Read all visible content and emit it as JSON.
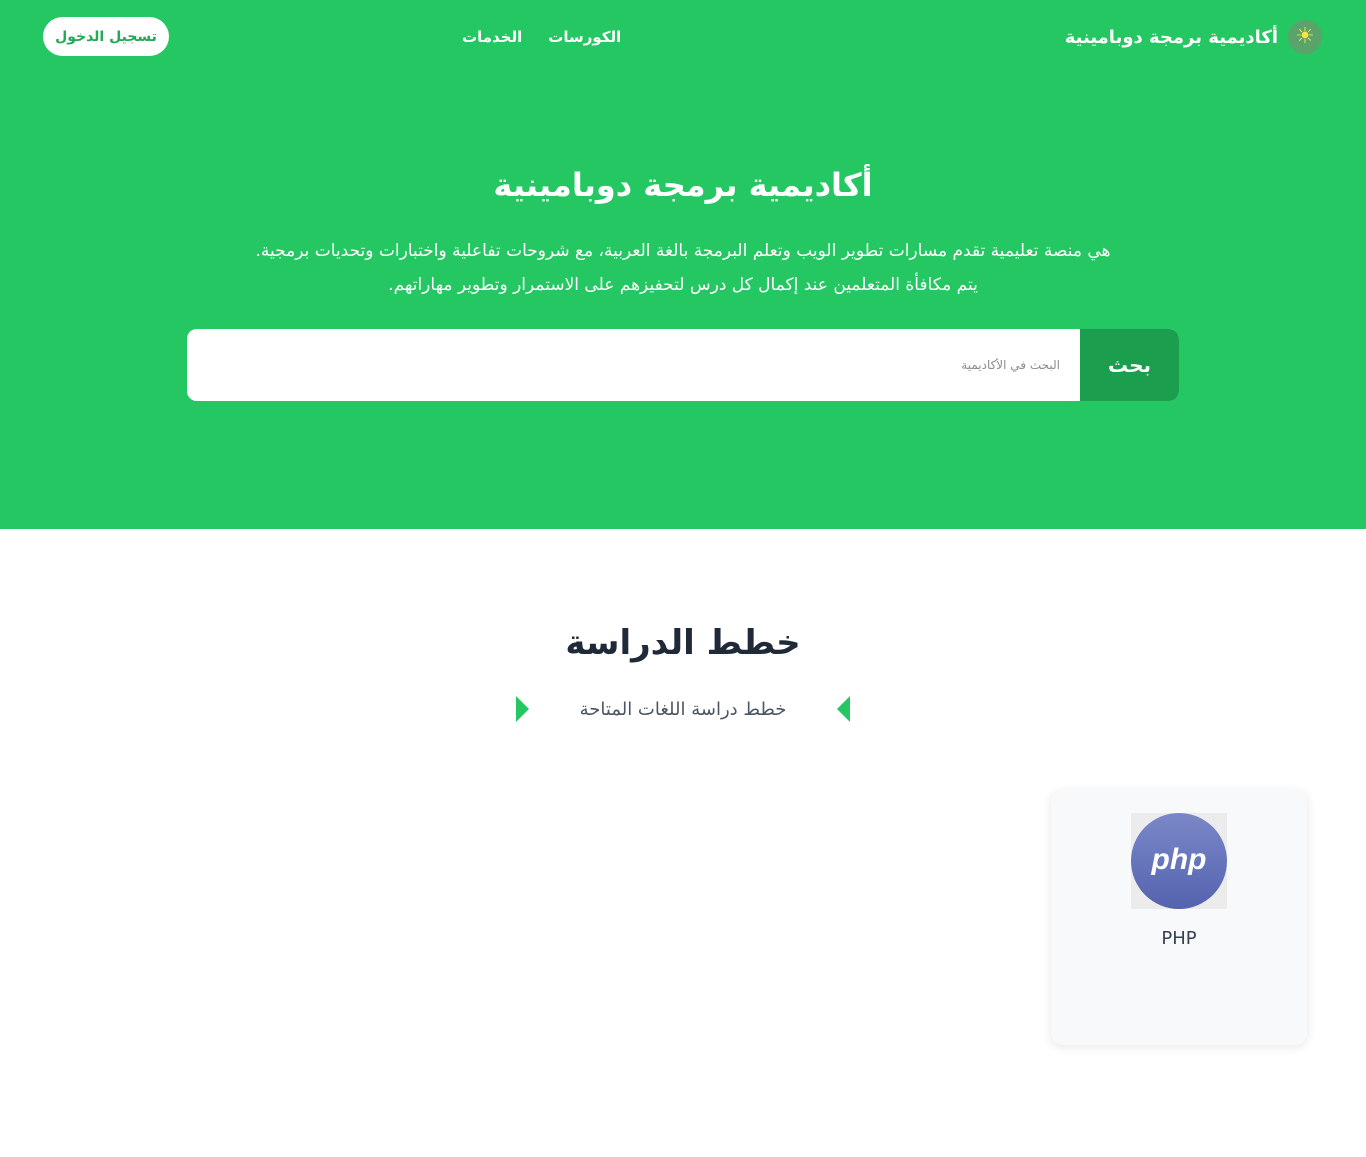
{
  "header": {
    "brand_icon": "sun-icon",
    "brand_name": "أكاديمية برمجة دوبامينية",
    "nav": [
      {
        "label": "الخدمات"
      },
      {
        "label": "الكورسات"
      }
    ],
    "login_label": "تسجيل الدخول"
  },
  "hero": {
    "title": "أكاديمية برمجة دوبامينية",
    "description": "هي منصة تعليمية تقدم مسارات تطوير الويب وتعلم البرمجة بالغة العربية، مع شروحات تفاعلية واختبارات وتحديات برمجية. يتم مكافأة المتعلمين عند إكمال كل درس لتحفيزهم على الاستمرار وتطوير مهاراتهم.",
    "search_placeholder": "البحث في الأكاديمية",
    "search_button": "بحث"
  },
  "plans": {
    "title": "خطط الدراسة",
    "subtitle": "خطط دراسة اللغات المتاحة",
    "cards": [
      {
        "title": "PHP",
        "logo_text": "php"
      }
    ]
  },
  "colors": {
    "primary": "#24c762",
    "primary_dark": "#1b9e4d",
    "php_logo": "#6474b8"
  }
}
